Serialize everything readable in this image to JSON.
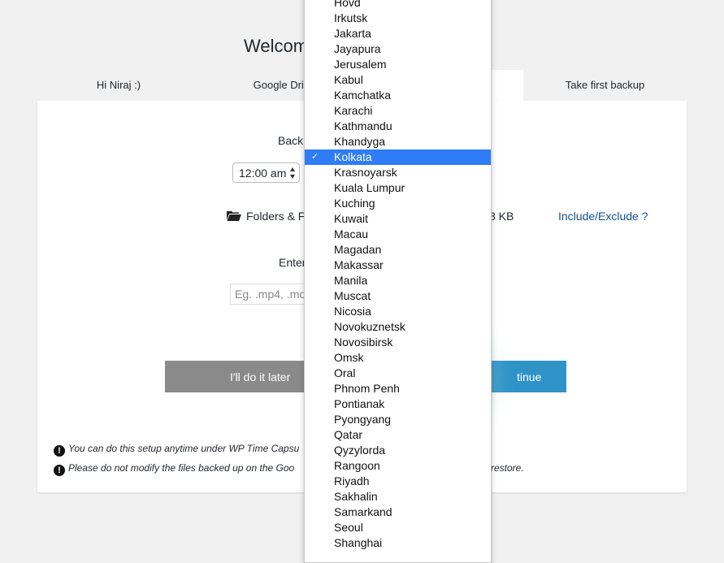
{
  "page_title": "Welcom",
  "steps": [
    {
      "label": "Hi Niraj :)"
    },
    {
      "label": "Google Driv"
    },
    {
      "label": ""
    },
    {
      "label": "Take first backup"
    }
  ],
  "panel": {
    "backup_label": "Backu",
    "time_value": "12:00 am",
    "folders_label": "Folders & F",
    "size_text": "8 KB",
    "include_link": "Include/Exclude ?",
    "enter_label": "Enter",
    "ext_placeholder": "Eg. .mp4, .mo",
    "later_button": "I'll do it later",
    "continue_button": "tinue",
    "note1": "You can do this setup anytime under WP Time Capsu",
    "note2": "Please do not modify the files backed up on the Goo",
    "note2_tail": "restore."
  },
  "timezone_dropdown": {
    "selected": "Kolkata",
    "check_glyph": "✓",
    "items": [
      "Hovd",
      "Irkutsk",
      "Jakarta",
      "Jayapura",
      "Jerusalem",
      "Kabul",
      "Kamchatka",
      "Karachi",
      "Kathmandu",
      "Khandyga",
      "Kolkata",
      "Krasnoyarsk",
      "Kuala Lumpur",
      "Kuching",
      "Kuwait",
      "Macau",
      "Magadan",
      "Makassar",
      "Manila",
      "Muscat",
      "Nicosia",
      "Novokuznetsk",
      "Novosibirsk",
      "Omsk",
      "Oral",
      "Phnom Penh",
      "Pontianak",
      "Pyongyang",
      "Qatar",
      "Qyzylorda",
      "Rangoon",
      "Riyadh",
      "Sakhalin",
      "Samarkand",
      "Seoul",
      "Shanghai"
    ]
  },
  "colors": {
    "accent": "#2e7cf6",
    "continue_bg": "#2f93c8",
    "later_bg": "#8a8a8a",
    "link": "#0e4f95"
  }
}
